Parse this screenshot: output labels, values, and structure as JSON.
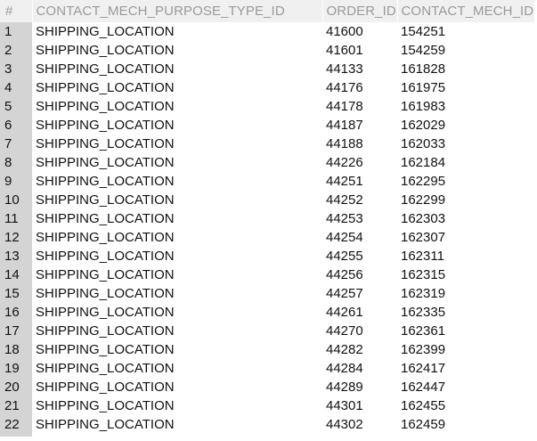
{
  "columns": [
    {
      "label": "#"
    },
    {
      "label": "CONTACT_MECH_PURPOSE_TYPE_ID"
    },
    {
      "label": "ORDER_ID"
    },
    {
      "label": "CONTACT_MECH_ID"
    }
  ],
  "rows": [
    [
      "1",
      "SHIPPING_LOCATION",
      "41600",
      "154251"
    ],
    [
      "2",
      "SHIPPING_LOCATION",
      "41601",
      "154259"
    ],
    [
      "3",
      "SHIPPING_LOCATION",
      "44133",
      "161828"
    ],
    [
      "4",
      "SHIPPING_LOCATION",
      "44176",
      "161975"
    ],
    [
      "5",
      "SHIPPING_LOCATION",
      "44178",
      "161983"
    ],
    [
      "6",
      "SHIPPING_LOCATION",
      "44187",
      "162029"
    ],
    [
      "7",
      "SHIPPING_LOCATION",
      "44188",
      "162033"
    ],
    [
      "8",
      "SHIPPING_LOCATION",
      "44226",
      "162184"
    ],
    [
      "9",
      "SHIPPING_LOCATION",
      "44251",
      "162295"
    ],
    [
      "10",
      "SHIPPING_LOCATION",
      "44252",
      "162299"
    ],
    [
      "11",
      "SHIPPING_LOCATION",
      "44253",
      "162303"
    ],
    [
      "12",
      "SHIPPING_LOCATION",
      "44254",
      "162307"
    ],
    [
      "13",
      "SHIPPING_LOCATION",
      "44255",
      "162311"
    ],
    [
      "14",
      "SHIPPING_LOCATION",
      "44256",
      "162315"
    ],
    [
      "15",
      "SHIPPING_LOCATION",
      "44257",
      "162319"
    ],
    [
      "16",
      "SHIPPING_LOCATION",
      "44261",
      "162335"
    ],
    [
      "17",
      "SHIPPING_LOCATION",
      "44270",
      "162361"
    ],
    [
      "18",
      "SHIPPING_LOCATION",
      "44282",
      "162399"
    ],
    [
      "19",
      "SHIPPING_LOCATION",
      "44284",
      "162417"
    ],
    [
      "20",
      "SHIPPING_LOCATION",
      "44289",
      "162447"
    ],
    [
      "21",
      "SHIPPING_LOCATION",
      "44301",
      "162455"
    ],
    [
      "22",
      "SHIPPING_LOCATION",
      "44302",
      "162459"
    ]
  ],
  "colors": {
    "header_bg": "#f0f0f0",
    "header_text": "#9a9a9a",
    "rownum_bg": "#d4d4d4",
    "cell_text": "#111111"
  }
}
